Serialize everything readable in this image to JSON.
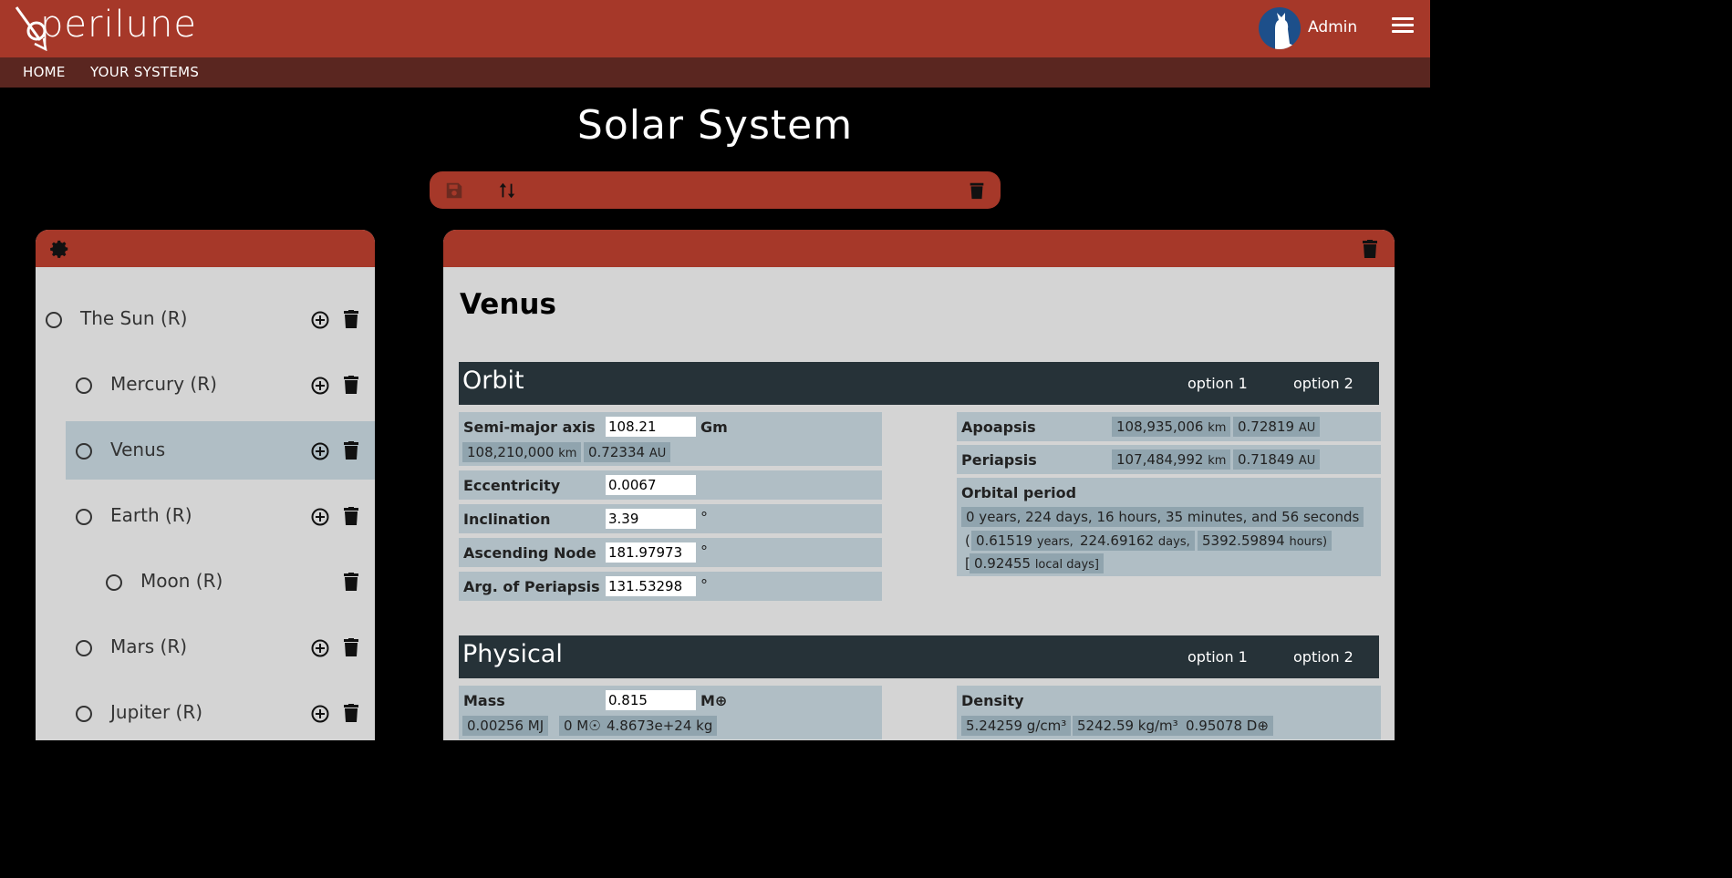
{
  "header": {
    "logo_text": "perilune",
    "user_name": "Admin",
    "colors": {
      "primary": "#a63829",
      "subnav": "#5a2620",
      "section": "#263238",
      "field": "#b0bec5",
      "chip": "#90a4ae"
    }
  },
  "nav": {
    "home": "HOME",
    "systems": "YOUR SYSTEMS"
  },
  "page": {
    "title": "Solar System"
  },
  "tree": {
    "items": [
      {
        "label": "The Sun (R)"
      },
      {
        "label": "Mercury (R)"
      },
      {
        "label": "Venus"
      },
      {
        "label": "Earth (R)"
      },
      {
        "label": "Moon (R)"
      },
      {
        "label": "Mars (R)"
      },
      {
        "label": "Jupiter (R)"
      }
    ]
  },
  "detail": {
    "title": "Venus",
    "orbit": {
      "title": "Orbit",
      "option1": "option 1",
      "option2": "option 2",
      "semi_major": {
        "label": "Semi-major axis",
        "value": "108.21",
        "unit": "Gm",
        "km": "108,210,000",
        "km_unit": "km",
        "au": "0.72334",
        "au_unit": "AU"
      },
      "eccentricity": {
        "label": "Eccentricity",
        "value": "0.0067"
      },
      "inclination": {
        "label": "Inclination",
        "value": "3.39",
        "unit": "°"
      },
      "asc_node": {
        "label": "Ascending Node",
        "value": "181.97973",
        "unit": "°"
      },
      "arg_periapsis": {
        "label": "Arg. of Periapsis",
        "value": "131.53298",
        "unit": "°"
      },
      "apoapsis": {
        "label": "Apoapsis",
        "km": "108,935,006",
        "km_unit": "km",
        "au": "0.72819",
        "au_unit": "AU"
      },
      "periapsis": {
        "label": "Periapsis",
        "km": "107,484,992",
        "km_unit": "km",
        "au": "0.71849",
        "au_unit": "AU"
      },
      "period": {
        "label": "Orbital period",
        "full": "0 years, 224 days, 16 hours, 35 minutes, and 56 seconds",
        "open_paren": "(",
        "years": "0.61519",
        "years_unit": "years,",
        "days": "224.69162",
        "days_unit": "days,",
        "hours": "5392.59894",
        "hours_unit": "hours)",
        "local_open": "[",
        "local": "0.92455",
        "local_unit": "local days]"
      }
    },
    "physical": {
      "title": "Physical",
      "option1": "option 1",
      "option2": "option 2",
      "mass": {
        "label": "Mass",
        "value": "0.815",
        "unit": "M⊕",
        "c1": "0.00256 MJ",
        "c2": "0 M☉",
        "c3": "4.8673e+24 kg"
      },
      "density": {
        "label": "Density",
        "v1": "5.24259 g/cm³",
        "v2": "5242.59 kg/m³",
        "v3": "0.95078 D⊕"
      }
    }
  }
}
